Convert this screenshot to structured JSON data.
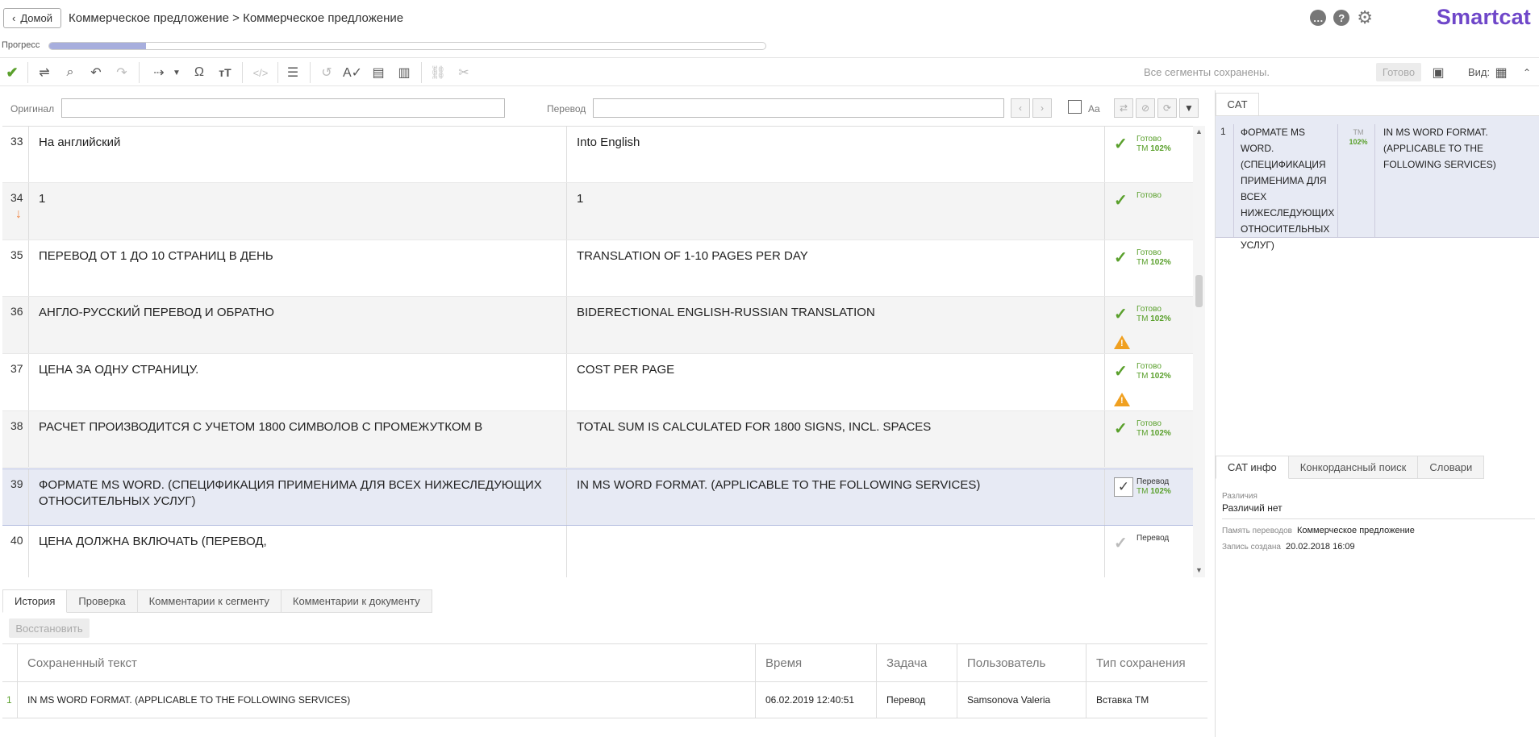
{
  "header": {
    "home_label": "Домой",
    "breadcrumb": "Коммерческое предложение > Коммерческое предложение",
    "logo": "Smartcat",
    "progress_label": "Прогресс",
    "progress_fraction": 0.135
  },
  "toolbar": {
    "saved_status": "Все сегменты сохранены.",
    "ready_label": "Готово",
    "view_label": "Вид:"
  },
  "filter": {
    "source_label": "Оригинал",
    "target_label": "Перевод",
    "case_label": "Aa"
  },
  "segments": [
    {
      "num": "33",
      "source": "На английский",
      "target": "Into English",
      "status": "Готово",
      "tm": "ТМ",
      "match": "102%",
      "warning": false
    },
    {
      "num": "34",
      "source": "1",
      "target": "1",
      "status": "Готово",
      "tm": "",
      "match": "",
      "warning": false
    },
    {
      "num": "35",
      "source": "ПЕРЕВОД ОТ 1 ДО 10 СТРАНИЦ В ДЕНЬ",
      "target": "TRANSLATION OF 1-10 PAGES PER DAY",
      "status": "Готово",
      "tm": "ТМ",
      "match": "102%",
      "warning": false
    },
    {
      "num": "36",
      "source": "АНГЛО-РУССКИЙ ПЕРЕВОД И ОБРАТНО",
      "target": "BIDERECTIONAL ENGLISH-RUSSIAN TRANSLATION",
      "status": "Готово",
      "tm": "ТМ",
      "match": "102%",
      "warning": true
    },
    {
      "num": "37",
      "source": "ЦЕНА ЗА ОДНУ СТРАНИЦУ.",
      "target": "COST PER PAGE",
      "status": "Готово",
      "tm": "ТМ",
      "match": "102%",
      "warning": true
    },
    {
      "num": "38",
      "source": "РАСЧЕТ ПРОИЗВОДИТСЯ С УЧЕТОМ 1800 СИМВОЛОВ С ПРОМЕЖУТКОМ В",
      "target": "TOTAL SUM IS CALCULATED FOR 1800 SIGNS, INCL. SPACES",
      "status": "Готово",
      "tm": "ТМ",
      "match": "102%",
      "warning": false
    },
    {
      "num": "39",
      "source": "ФОРМАТЕ MS WORD. (СПЕЦИФИКАЦИЯ ПРИМЕНИМА ДЛЯ ВСЕХ НИЖЕСЛЕДУЮЩИХ ОТНОСИТЕЛЬНЫХ УСЛУГ)",
      "target": "IN MS WORD FORMAT. (APPLICABLE TO THE FOLLOWING SERVICES)",
      "status": "Перевод",
      "tm": "ТМ",
      "match": "102%",
      "warning": false
    },
    {
      "num": "40",
      "source": "ЦЕНА ДОЛЖНА ВКЛЮЧАТЬ (ПЕРЕВОД,",
      "target": "",
      "status": "Перевод",
      "tm": "",
      "match": "",
      "warning": false
    }
  ],
  "bottom": {
    "tabs": [
      "История",
      "Проверка",
      "Комментарии к сегменту",
      "Комментарии к документу"
    ],
    "restore_label": "Восстановить",
    "columns": [
      "Сохраненный текст",
      "Время",
      "Задача",
      "Пользователь",
      "Тип сохранения"
    ],
    "rows": [
      {
        "num": "1",
        "text": "IN MS WORD FORMAT. (APPLICABLE TO THE FOLLOWING SERVICES)",
        "time": "06.02.2019 12:40:51",
        "task": "Перевод",
        "user": "Samsonova Valeria",
        "type": "Вставка ТМ"
      }
    ]
  },
  "right": {
    "cat_tab": "CAT",
    "cat_num": "1",
    "cat_source": "ФОРМАТЕ MS WORD. (СПЕЦИФИКАЦИЯ ПРИМЕНИМА ДЛЯ ВСЕХ НИЖЕСЛЕДУЮЩИХ ОТНОСИТЕЛЬНЫХ УСЛУГ)",
    "cat_tm": "ТМ",
    "cat_match": "102%",
    "cat_target": "IN MS WORD FORMAT. (APPLICABLE TO THE FOLLOWING SERVICES)",
    "tabs": [
      "CAT инфо",
      "Конкордансный поиск",
      "Словари"
    ],
    "diff_label": "Различия",
    "diff_value": "Различий нет",
    "tm_label": "Память переводов",
    "tm_value": "Коммерческое предложение",
    "created_label": "Запись создана",
    "created_value": "20.02.2018 16:09"
  },
  "colors": {
    "accent": "#6f47c9",
    "ready_green": "#5aa02c",
    "warning": "#f0a020",
    "active_row": "#e7eaf4"
  }
}
